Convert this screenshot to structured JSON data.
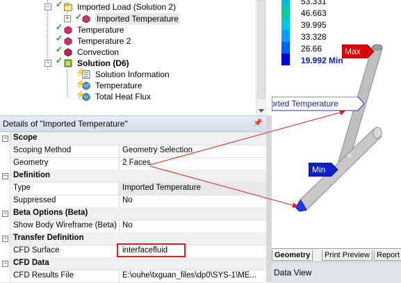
{
  "tree": {
    "items": [
      {
        "label": "Imported Load (Solution 2)"
      },
      {
        "label": "Imported Temperature"
      },
      {
        "label": "Temperature"
      },
      {
        "label": "Temperature 2"
      },
      {
        "label": "Convection"
      },
      {
        "label": "Solution (D6)"
      },
      {
        "label": "Solution Information"
      },
      {
        "label": "Temperature"
      },
      {
        "label": "Total Heat Flux"
      }
    ]
  },
  "details": {
    "title": "Details of \"Imported Temperature\"",
    "pin": "ᵖ",
    "rows": [
      {
        "name": "Scope",
        "value": ""
      },
      {
        "name": "Scoping Method",
        "value": "Geometry Selection"
      },
      {
        "name": "Geometry",
        "value": "2 Faces"
      },
      {
        "name": "Definition",
        "value": ""
      },
      {
        "name": "Type",
        "value": "Imported Temperature"
      },
      {
        "name": "Suppressed",
        "value": "No"
      },
      {
        "name": "Beta Options (Beta)",
        "value": ""
      },
      {
        "name": "Show Body Wireframe (Beta)",
        "value": "No"
      },
      {
        "name": "Transfer Definition",
        "value": ""
      },
      {
        "name": "CFD Surface",
        "value": "interfacefluid"
      },
      {
        "name": "CFD Data",
        "value": ""
      },
      {
        "name": "CFD Results File",
        "value": "E:\\ouhe\\txguan_files\\dp0\\SYS-1\\ME..."
      }
    ]
  },
  "legend": {
    "values": [
      "53.331",
      "46.663",
      "39.995",
      "33.328",
      "26.66",
      "19.992 Min"
    ],
    "colors": [
      "#00b8d8",
      "#00d0b0",
      "#00c0e0",
      "#0090ff",
      "#0050ff",
      "#0000e0"
    ]
  },
  "viewport": {
    "max_label": "Max",
    "min_label": "Min",
    "annotation": "orted Temperature"
  },
  "tabs": [
    "Geometry",
    "Print Preview",
    "Report"
  ],
  "dataview": {
    "title": "Data View"
  },
  "colors": {
    "max": "#e00000",
    "min": "#0a20c8",
    "highlight": "#d62020"
  }
}
